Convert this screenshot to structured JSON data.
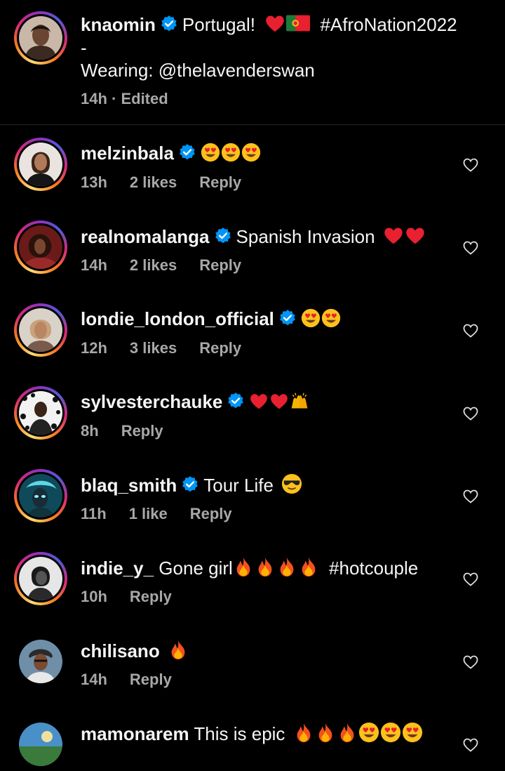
{
  "caption": {
    "username": "knaomin",
    "text_before": "Portugal!",
    "hashtag": "#AfroNation2022",
    "dash": "-",
    "wearing": "Wearing: @thelavenderswan",
    "meta": "14h · Edited",
    "emojis": [
      "red-heart",
      "portugal-flag"
    ]
  },
  "comments": [
    {
      "username": "melzinbala",
      "verified": true,
      "text": "",
      "emojis": [
        "heart-eyes",
        "heart-eyes",
        "heart-eyes"
      ],
      "time": "13h",
      "likes": "2 likes",
      "reply": "Reply"
    },
    {
      "username": "realnomalanga",
      "verified": true,
      "text": "Spanish Invasion",
      "emojis": [
        "red-heart",
        "red-heart"
      ],
      "time": "14h",
      "likes": "2 likes",
      "reply": "Reply"
    },
    {
      "username": "londie_london_official",
      "verified": true,
      "text": "",
      "emojis": [
        "heart-eyes",
        "heart-eyes"
      ],
      "time": "12h",
      "likes": "3 likes",
      "reply": "Reply"
    },
    {
      "username": "sylvesterchauke",
      "verified": true,
      "text": "",
      "emojis": [
        "red-heart",
        "red-heart",
        "raised-hands"
      ],
      "time": "8h",
      "likes": "",
      "reply": "Reply"
    },
    {
      "username": "blaq_smith",
      "verified": true,
      "text": "Tour Life",
      "emojis": [
        "sunglasses"
      ],
      "time": "11h",
      "likes": "1 like",
      "reply": "Reply"
    },
    {
      "username": "indie_y_",
      "verified": false,
      "text": "Gone girl",
      "emojis": [
        "fire",
        "fire",
        "fire",
        "fire"
      ],
      "text_after": "#hotcouple",
      "time": "10h",
      "likes": "",
      "reply": "Reply"
    },
    {
      "username": "chilisano",
      "verified": false,
      "text": "",
      "emojis": [
        "fire"
      ],
      "time": "14h",
      "likes": "",
      "reply": "Reply"
    },
    {
      "username": "mamonarem",
      "verified": false,
      "text": "This is epic",
      "emojis": [
        "fire",
        "fire",
        "fire",
        "heart-eyes",
        "heart-eyes",
        "heart-eyes"
      ],
      "time": "",
      "likes": "",
      "reply": ""
    }
  ],
  "colors": {
    "background": "#000000",
    "text": "#f5f5f5",
    "meta": "#a8a8a8",
    "verified": "#0095f6",
    "divider": "#262626"
  }
}
